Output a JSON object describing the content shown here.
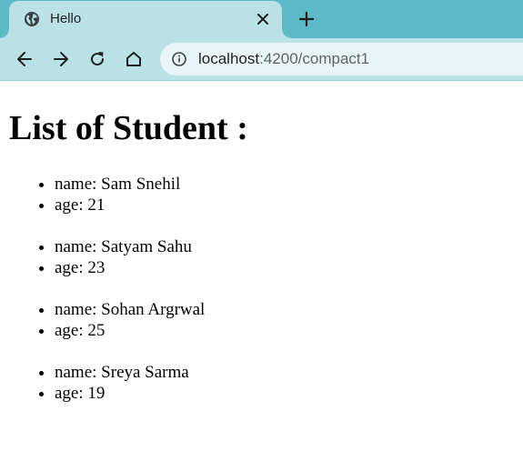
{
  "browser": {
    "tab": {
      "title": "Hello",
      "favicon": "globe-icon"
    },
    "address": {
      "host": "localhost",
      "path": ":4200/compact1"
    }
  },
  "page": {
    "heading": "List of Student :",
    "students": [
      {
        "name_line": "name: Sam Snehil",
        "age_line": "age: 21"
      },
      {
        "name_line": "name: Satyam Sahu",
        "age_line": "age: 23"
      },
      {
        "name_line": "name: Sohan Argrwal",
        "age_line": "age: 25"
      },
      {
        "name_line": "name: Sreya Sarma",
        "age_line": "age: 19"
      }
    ]
  },
  "colors": {
    "tabstrip": "#5bbac5",
    "toolbar": "#b9e1e6",
    "omnibox": "#e8f6f8"
  }
}
